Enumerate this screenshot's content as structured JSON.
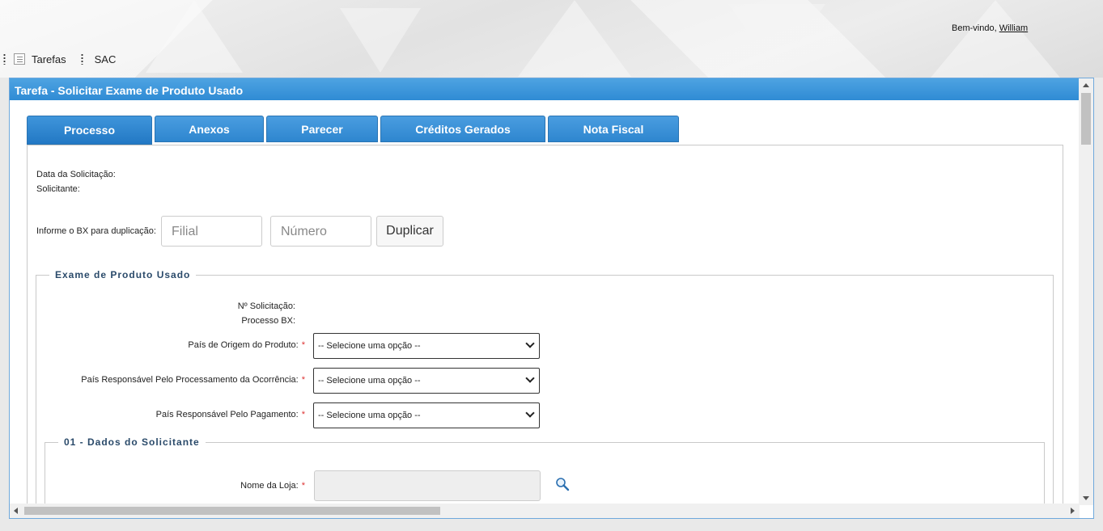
{
  "header": {
    "welcome_prefix": "Bem-vindo,",
    "user_name": "William"
  },
  "nav": {
    "items": [
      {
        "label": "Tarefas",
        "icon": "notepad-icon"
      },
      {
        "label": "SAC"
      }
    ]
  },
  "window": {
    "title": "Tarefa - Solicitar Exame de Produto Usado"
  },
  "tabs": [
    {
      "label": "Processo",
      "active": true
    },
    {
      "label": "Anexos"
    },
    {
      "label": "Parecer"
    },
    {
      "label": "Créditos Gerados"
    },
    {
      "label": "Nota Fiscal"
    }
  ],
  "processo": {
    "data_solicitacao_label": "Data da Solicitação:",
    "solicitante_label": "Solicitante:",
    "bx_label": "Informe o BX para duplicação:",
    "filial_placeholder": "Filial",
    "numero_placeholder": "Número",
    "duplicar_button": "Duplicar"
  },
  "exame": {
    "legend": "Exame de Produto Usado",
    "n_solicitacao_label": "Nº Solicitação:",
    "processo_bx_label": "Processo BX:",
    "pais_origem_label": "País de Origem do Produto:",
    "pais_processamento_label": "País Responsável Pelo Processamento da Ocorrência:",
    "pais_pagamento_label": "País Responsável Pelo Pagamento:",
    "select_default": "-- Selecione uma opção --",
    "required_mark": "*"
  },
  "dados_solicitante": {
    "legend": "01 - Dados do Solicitante",
    "nome_loja_label": "Nome da Loja:"
  },
  "colors": {
    "title_bar": "#2f8bd4",
    "tab": "#2e86cf",
    "required": "#dd3333",
    "legend_text": "#2a4a6a"
  }
}
